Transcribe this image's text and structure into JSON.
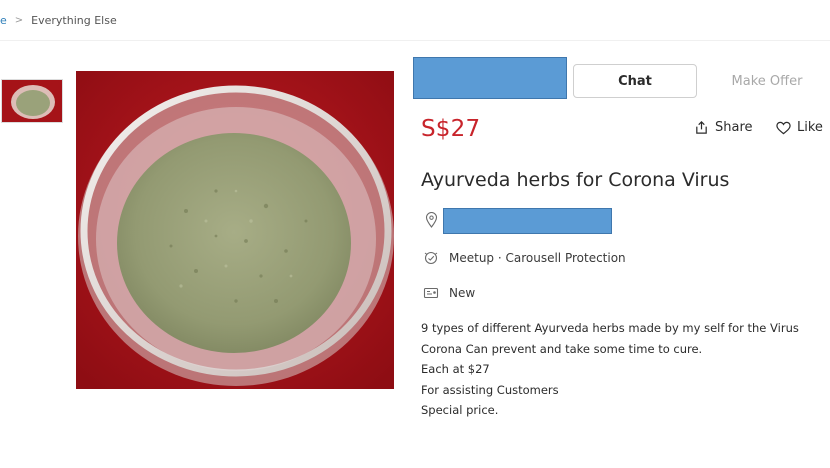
{
  "breadcrumb": {
    "home_fragment": "e",
    "separator": ">",
    "category": "Everything Else"
  },
  "listing": {
    "price": "S$27",
    "title": "Ayurveda herbs for Corona Virus",
    "meetup": "Meetup · Carousell Protection",
    "condition": "New",
    "description_lines": [
      "9 types of different Ayurveda herbs made by my self for the Virus",
      "Corona Can prevent and take some time to cure.",
      "Each at $27",
      "For assisting Customers",
      "Special price."
    ]
  },
  "actions": {
    "chat_label": "Chat",
    "offer_label": "Make Offer",
    "share_label": "Share",
    "like_label": "Like"
  },
  "icons": {
    "share": "share-icon",
    "like": "heart-icon",
    "location": "location-pin-icon",
    "meetup": "meetup-icon",
    "condition": "condition-tag-icon"
  },
  "colors": {
    "price": "#c8242b",
    "redaction": "#5b9bd5",
    "photo_background": "#b01018",
    "powder": "#9aa27a"
  }
}
